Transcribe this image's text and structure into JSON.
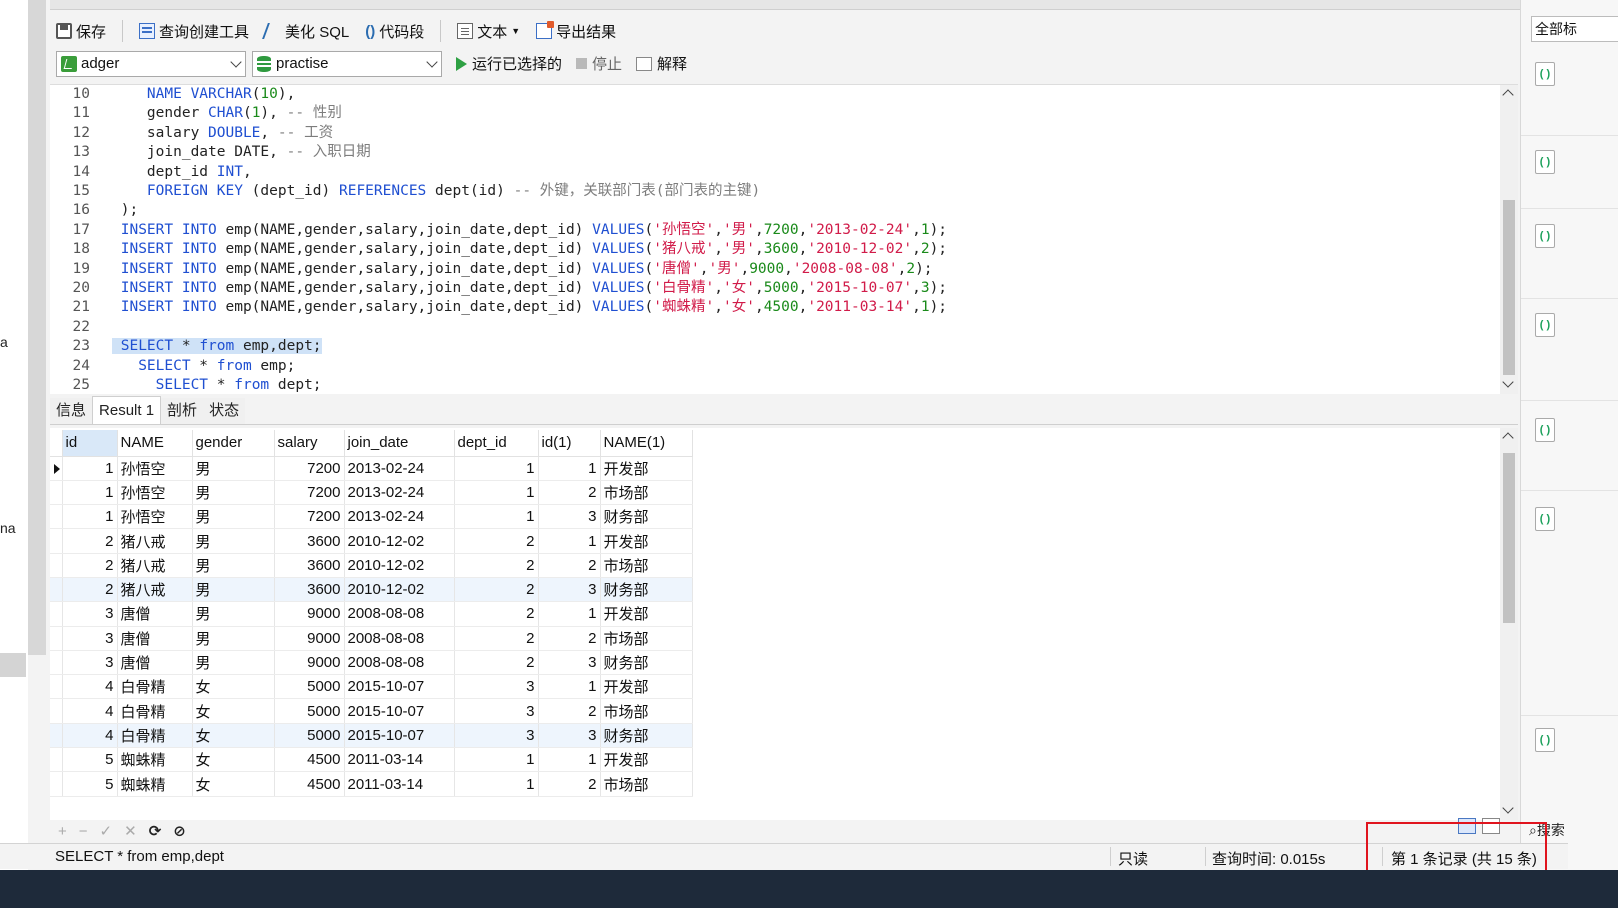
{
  "left_fragments": [
    "a",
    "na"
  ],
  "toolbar": {
    "save": "保存",
    "query_builder": "查询创建工具",
    "beautify": "美化 SQL",
    "code_snippet": "代码段",
    "code_snippet_glyph": "()",
    "text": "文本",
    "export": "导出结果"
  },
  "connection": {
    "value": "adger"
  },
  "database": {
    "value": "practise"
  },
  "run_bar": {
    "run_selected": "运行已选择的",
    "stop": "停止",
    "explain": "解释"
  },
  "editor": {
    "lines": [
      {
        "n": "10",
        "tokens": [
          [
            "id",
            "    "
          ],
          [
            "kw",
            "NAME VARCHAR"
          ],
          [
            "id",
            "("
          ],
          [
            "nm",
            "10"
          ],
          [
            "id",
            "),"
          ]
        ]
      },
      {
        "n": "11",
        "tokens": [
          [
            "id",
            "    gender "
          ],
          [
            "kw",
            "CHAR"
          ],
          [
            "id",
            "("
          ],
          [
            "nm",
            "1"
          ],
          [
            "id",
            "), "
          ],
          [
            "cm",
            "-- 性别"
          ]
        ]
      },
      {
        "n": "12",
        "tokens": [
          [
            "id",
            "    salary "
          ],
          [
            "kw",
            "DOUBLE"
          ],
          [
            "id",
            ", "
          ],
          [
            "cm",
            "-- 工资"
          ]
        ]
      },
      {
        "n": "13",
        "tokens": [
          [
            "id",
            "    join_date DATE, "
          ],
          [
            "cm",
            "-- 入职日期"
          ]
        ]
      },
      {
        "n": "14",
        "tokens": [
          [
            "id",
            "    dept_id "
          ],
          [
            "kw",
            "INT"
          ],
          [
            "id",
            ","
          ]
        ]
      },
      {
        "n": "15",
        "tokens": [
          [
            "id",
            "    "
          ],
          [
            "kw",
            "FOREIGN KEY"
          ],
          [
            "id",
            " (dept_id) "
          ],
          [
            "kw",
            "REFERENCES"
          ],
          [
            "id",
            " dept(id) "
          ],
          [
            "cm",
            "-- 外键，关联部门表(部门表的主键)"
          ]
        ]
      },
      {
        "n": "16",
        "tokens": [
          [
            "id",
            " );"
          ]
        ]
      },
      {
        "n": "17",
        "tokens": [
          [
            "kw",
            " INSERT INTO"
          ],
          [
            "id",
            " emp(NAME,gender,salary,join_date,dept_id) "
          ],
          [
            "kw",
            "VALUES"
          ],
          [
            "id",
            "("
          ],
          [
            "st",
            "'孙悟空'"
          ],
          [
            "id",
            ","
          ],
          [
            "st",
            "'男'"
          ],
          [
            "id",
            ","
          ],
          [
            "nm",
            "7200"
          ],
          [
            "id",
            ","
          ],
          [
            "st",
            "'2013-02-24'"
          ],
          [
            "id",
            ","
          ],
          [
            "nm",
            "1"
          ],
          [
            "id",
            ");"
          ]
        ]
      },
      {
        "n": "18",
        "tokens": [
          [
            "kw",
            " INSERT INTO"
          ],
          [
            "id",
            " emp(NAME,gender,salary,join_date,dept_id) "
          ],
          [
            "kw",
            "VALUES"
          ],
          [
            "id",
            "("
          ],
          [
            "st",
            "'猪八戒'"
          ],
          [
            "id",
            ","
          ],
          [
            "st",
            "'男'"
          ],
          [
            "id",
            ","
          ],
          [
            "nm",
            "3600"
          ],
          [
            "id",
            ","
          ],
          [
            "st",
            "'2010-12-02'"
          ],
          [
            "id",
            ","
          ],
          [
            "nm",
            "2"
          ],
          [
            "id",
            ");"
          ]
        ]
      },
      {
        "n": "19",
        "tokens": [
          [
            "kw",
            " INSERT INTO"
          ],
          [
            "id",
            " emp(NAME,gender,salary,join_date,dept_id) "
          ],
          [
            "kw",
            "VALUES"
          ],
          [
            "id",
            "("
          ],
          [
            "st",
            "'唐僧'"
          ],
          [
            "id",
            ","
          ],
          [
            "st",
            "'男'"
          ],
          [
            "id",
            ","
          ],
          [
            "nm",
            "9000"
          ],
          [
            "id",
            ","
          ],
          [
            "st",
            "'2008-08-08'"
          ],
          [
            "id",
            ","
          ],
          [
            "nm",
            "2"
          ],
          [
            "id",
            ");"
          ]
        ]
      },
      {
        "n": "20",
        "tokens": [
          [
            "kw",
            " INSERT INTO"
          ],
          [
            "id",
            " emp(NAME,gender,salary,join_date,dept_id) "
          ],
          [
            "kw",
            "VALUES"
          ],
          [
            "id",
            "("
          ],
          [
            "st",
            "'白骨精'"
          ],
          [
            "id",
            ","
          ],
          [
            "st",
            "'女'"
          ],
          [
            "id",
            ","
          ],
          [
            "nm",
            "5000"
          ],
          [
            "id",
            ","
          ],
          [
            "st",
            "'2015-10-07'"
          ],
          [
            "id",
            ","
          ],
          [
            "nm",
            "3"
          ],
          [
            "id",
            ");"
          ]
        ]
      },
      {
        "n": "21",
        "tokens": [
          [
            "kw",
            " INSERT INTO"
          ],
          [
            "id",
            " emp(NAME,gender,salary,join_date,dept_id) "
          ],
          [
            "kw",
            "VALUES"
          ],
          [
            "id",
            "("
          ],
          [
            "st",
            "'蜘蛛精'"
          ],
          [
            "id",
            ","
          ],
          [
            "st",
            "'女'"
          ],
          [
            "id",
            ","
          ],
          [
            "nm",
            "4500"
          ],
          [
            "id",
            ","
          ],
          [
            "st",
            "'2011-03-14'"
          ],
          [
            "id",
            ","
          ],
          [
            "nm",
            "1"
          ],
          [
            "id",
            ");"
          ]
        ]
      },
      {
        "n": "22",
        "tokens": []
      },
      {
        "n": "23",
        "highlight": true,
        "tokens": [
          [
            "kw",
            " SELECT"
          ],
          [
            "id",
            " * "
          ],
          [
            "kw",
            "from"
          ],
          [
            "id",
            " emp,dept;"
          ]
        ]
      },
      {
        "n": "24",
        "tokens": [
          [
            "kw",
            "   SELECT"
          ],
          [
            "id",
            " * "
          ],
          [
            "kw",
            "from"
          ],
          [
            "id",
            " emp;"
          ]
        ]
      },
      {
        "n": "25",
        "tokens": [
          [
            "kw",
            "     SELECT"
          ],
          [
            "id",
            " * "
          ],
          [
            "kw",
            "from"
          ],
          [
            "id",
            " dept;"
          ]
        ]
      }
    ]
  },
  "result_tabs": [
    {
      "label": "信息",
      "active": false
    },
    {
      "label": "Result 1",
      "active": true
    },
    {
      "label": "剖析",
      "active": false
    },
    {
      "label": "状态",
      "active": false
    }
  ],
  "grid": {
    "columns": [
      "id",
      "NAME",
      "gender",
      "salary",
      "join_date",
      "dept_id",
      "id(1)",
      "NAME(1)"
    ],
    "rows": [
      [
        "1",
        "孙悟空",
        "男",
        "7200",
        "2013-02-24",
        "1",
        "1",
        "开发部"
      ],
      [
        "1",
        "孙悟空",
        "男",
        "7200",
        "2013-02-24",
        "1",
        "2",
        "市场部"
      ],
      [
        "1",
        "孙悟空",
        "男",
        "7200",
        "2013-02-24",
        "1",
        "3",
        "财务部"
      ],
      [
        "2",
        "猪八戒",
        "男",
        "3600",
        "2010-12-02",
        "2",
        "1",
        "开发部"
      ],
      [
        "2",
        "猪八戒",
        "男",
        "3600",
        "2010-12-02",
        "2",
        "2",
        "市场部"
      ],
      [
        "2",
        "猪八戒",
        "男",
        "3600",
        "2010-12-02",
        "2",
        "3",
        "财务部"
      ],
      [
        "3",
        "唐僧",
        "男",
        "9000",
        "2008-08-08",
        "2",
        "1",
        "开发部"
      ],
      [
        "3",
        "唐僧",
        "男",
        "9000",
        "2008-08-08",
        "2",
        "2",
        "市场部"
      ],
      [
        "3",
        "唐僧",
        "男",
        "9000",
        "2008-08-08",
        "2",
        "3",
        "财务部"
      ],
      [
        "4",
        "白骨精",
        "女",
        "5000",
        "2015-10-07",
        "3",
        "1",
        "开发部"
      ],
      [
        "4",
        "白骨精",
        "女",
        "5000",
        "2015-10-07",
        "3",
        "2",
        "市场部"
      ],
      [
        "4",
        "白骨精",
        "女",
        "5000",
        "2015-10-07",
        "3",
        "3",
        "财务部"
      ],
      [
        "5",
        "蜘蛛精",
        "女",
        "4500",
        "2011-03-14",
        "1",
        "1",
        "开发部"
      ],
      [
        "5",
        "蜘蛛精",
        "女",
        "4500",
        "2011-03-14",
        "1",
        "2",
        "市场部"
      ]
    ]
  },
  "bottom_controls": [
    "+",
    "−",
    "✓",
    "✕",
    "⟳",
    "⊘"
  ],
  "statusbar": {
    "sql": "SELECT * from emp,dept",
    "readonly": "只读",
    "query_time": "查询时间: 0.015s",
    "records": "第 1 条记录 (共 15 条)"
  },
  "right_panel": {
    "header": "全部标",
    "search": "搜索"
  },
  "colors": {
    "keyword": "#1f4fd1",
    "string": "#d11b49",
    "number": "#1a8a1a",
    "comment": "#7d7d7d",
    "selection": "#cfe2f7",
    "highlight_box": "#e0141e"
  }
}
